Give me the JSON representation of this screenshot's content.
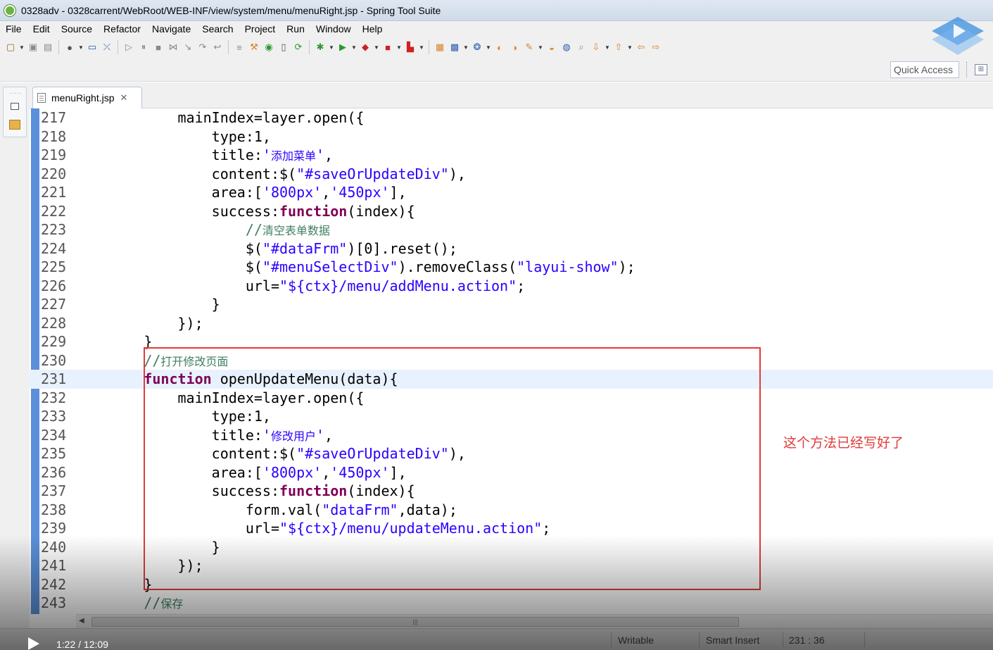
{
  "window": {
    "title": "0328adv - 0328carrent/WebRoot/WEB-INF/view/system/menu/menuRight.jsp - Spring Tool Suite"
  },
  "menu": [
    "File",
    "Edit",
    "Source",
    "Refactor",
    "Navigate",
    "Search",
    "Project",
    "Run",
    "Window",
    "Help"
  ],
  "quick_access": {
    "label": "Quick Access"
  },
  "editor": {
    "tab_label": "menuRight.jsp",
    "current_line": 231,
    "lines": [
      {
        "num": "217",
        "text": "            mainIndex=layer.open({"
      },
      {
        "num": "218",
        "text": "                type:1,"
      },
      {
        "num": "219",
        "text": "                title:'添加菜单',"
      },
      {
        "num": "220",
        "text": "                content:$(\"#saveOrUpdateDiv\"),"
      },
      {
        "num": "221",
        "text": "                area:['800px','450px'],"
      },
      {
        "num": "222",
        "text": "                success:function(index){"
      },
      {
        "num": "223",
        "text": "                    //清空表单数据"
      },
      {
        "num": "224",
        "text": "                    $(\"#dataFrm\")[0].reset();"
      },
      {
        "num": "225",
        "text": "                    $(\"#menuSelectDiv\").removeClass(\"layui-show\");"
      },
      {
        "num": "226",
        "text": "                    url=\"${ctx}/menu/addMenu.action\";"
      },
      {
        "num": "227",
        "text": "                }"
      },
      {
        "num": "228",
        "text": "            });"
      },
      {
        "num": "229",
        "text": "        }"
      },
      {
        "num": "230",
        "text": "        //打开修改页面"
      },
      {
        "num": "231",
        "text": "        function openUpdateMenu(data){"
      },
      {
        "num": "232",
        "text": "            mainIndex=layer.open({"
      },
      {
        "num": "233",
        "text": "                type:1,"
      },
      {
        "num": "234",
        "text": "                title:'修改用户',"
      },
      {
        "num": "235",
        "text": "                content:$(\"#saveOrUpdateDiv\"),"
      },
      {
        "num": "236",
        "text": "                area:['800px','450px'],"
      },
      {
        "num": "237",
        "text": "                success:function(index){"
      },
      {
        "num": "238",
        "text": "                    form.val(\"dataFrm\",data);"
      },
      {
        "num": "239",
        "text": "                    url=\"${ctx}/menu/updateMenu.action\";"
      },
      {
        "num": "240",
        "text": "                }"
      },
      {
        "num": "241",
        "text": "            });"
      },
      {
        "num": "242",
        "text": "        }"
      },
      {
        "num": "243",
        "text": "        //保存"
      }
    ]
  },
  "annotation": {
    "text": "这个方法已经写好了",
    "color": "#e23a3a"
  },
  "status": {
    "writable": "Writable",
    "insert_mode": "Smart Insert",
    "position": "231 : 36"
  },
  "video": {
    "time": "1:22 / 12:09"
  },
  "colors": {
    "keyword": "#7f0055",
    "string": "#2a00ff",
    "comment": "#3f7f5f",
    "current_line": "#e8f2fe",
    "ruler": "#5b8fd9"
  }
}
